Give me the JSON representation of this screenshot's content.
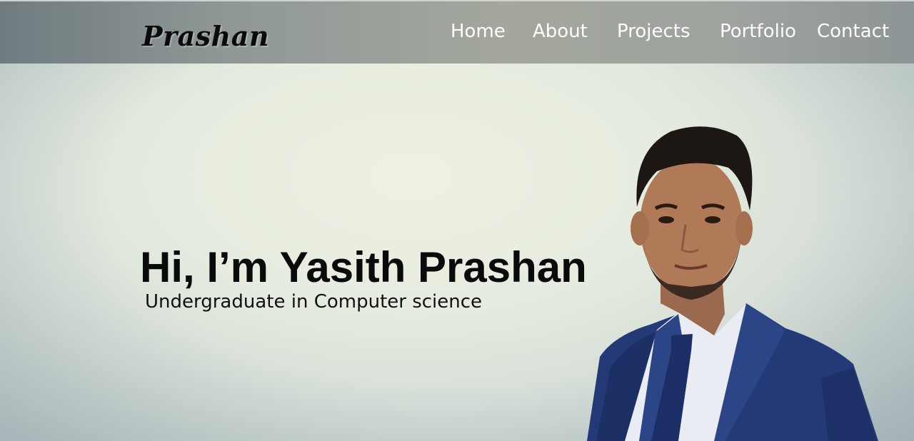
{
  "header": {
    "logo": "Prashan",
    "nav": [
      {
        "label": "Home"
      },
      {
        "label": "About"
      },
      {
        "label": "Projects"
      },
      {
        "label": "Portfolio"
      },
      {
        "label": "Contact"
      }
    ]
  },
  "hero": {
    "title": "Hi, I’m Yasith Prashan",
    "subtitle": "Undergraduate in Computer science",
    "portrait": "profile-photo"
  }
}
